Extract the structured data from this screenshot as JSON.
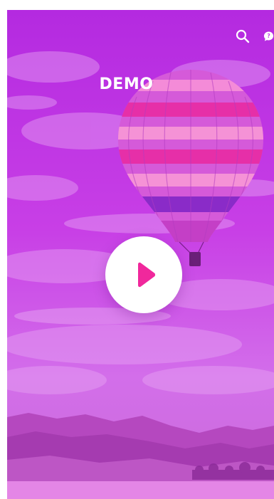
{
  "header": {
    "title": "DEMO"
  },
  "icons": {
    "search": "search-icon",
    "help": "help-bubble-icon",
    "play": "play-icon"
  },
  "colors": {
    "overlay": "#c33be6",
    "accent": "#f0289c",
    "text": "#ffffff"
  }
}
